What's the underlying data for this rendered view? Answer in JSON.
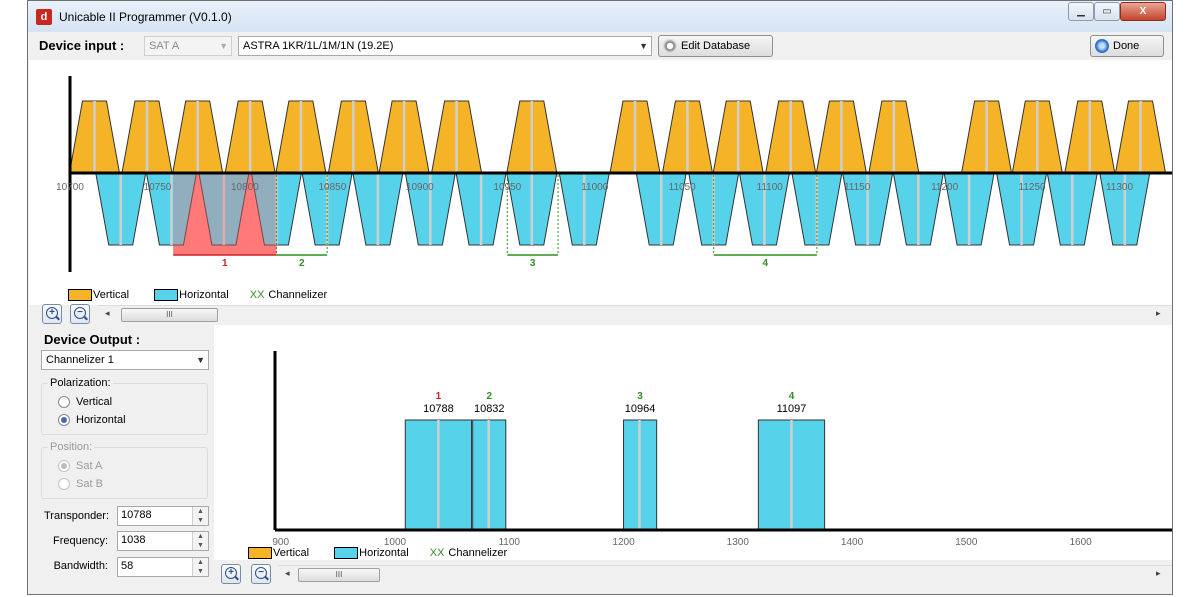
{
  "window": {
    "title": "Unicable II Programmer (V0.1.0)",
    "icon_letter": "d"
  },
  "window_buttons": {
    "minimize": "▁",
    "maximize": "▭",
    "close": "X"
  },
  "toolbar": {
    "device_input_label": "Device input :",
    "sat_select": "SAT A",
    "satellite_select": "ASTRA 1KR/1L/1M/1N (19.2E)",
    "edit_database_label": "Edit Database",
    "done_label": "Done"
  },
  "colors": {
    "vertical": "#f5b327",
    "horizontal": "#56d3eb",
    "channelizer_red": "#ff6b6b",
    "channelizer_green": "#2f8f1f"
  },
  "legend": {
    "vertical": "Vertical",
    "horizontal": "Horizontal",
    "channelizer_xx": "XX",
    "channelizer": "Channelizer"
  },
  "scrollbar": {
    "thumb_glyph": "III",
    "left": "◂",
    "right": "▸"
  },
  "chart_data": [
    {
      "type": "bar",
      "name": "transponder-spectrum",
      "x_ticks": [
        10700,
        10750,
        10800,
        10850,
        10900,
        10950,
        11000,
        11050,
        11100,
        11150,
        11200,
        11250,
        11300
      ],
      "x_tick_labels": [
        "10700",
        "10750",
        "10800",
        "10850",
        "10900",
        "10950",
        "11000",
        "11050",
        "11100",
        "11150",
        "11200",
        "11250",
        "11300"
      ],
      "xlim": [
        10700,
        11330
      ],
      "vertical_transponders": [
        10714,
        10744,
        10773,
        10803,
        10832,
        10862,
        10891,
        10921,
        10964,
        11023,
        11053,
        11082,
        11112,
        11141,
        11171,
        11224,
        11253,
        11283,
        11312
      ],
      "horizontal_transponders": [
        10729,
        10758,
        10788,
        10818,
        10847,
        10876,
        10906,
        10935,
        10964,
        10994,
        11038,
        11068,
        11097,
        11127,
        11156,
        11185,
        11214,
        11244,
        11273,
        11303
      ],
      "channelizers": [
        {
          "label": "1",
          "start": 10759,
          "end": 10818,
          "color": "red"
        },
        {
          "label": "2",
          "start": 10818,
          "end": 10847,
          "color": "green"
        },
        {
          "label": "3",
          "start": 10950,
          "end": 10979,
          "color": "green"
        },
        {
          "label": "4",
          "start": 11068,
          "end": 11127,
          "color": "green"
        }
      ]
    },
    {
      "type": "bar",
      "name": "device-output",
      "x_ticks": [
        900,
        1000,
        1100,
        1200,
        1300,
        1400,
        1500,
        1600
      ],
      "x_tick_labels": [
        "900",
        "1000",
        "1100",
        "1200",
        "1300",
        "1400",
        "1500",
        "1600"
      ],
      "xlim": [
        895,
        1680
      ],
      "channels": [
        {
          "label": "1",
          "frequency_label": "10788",
          "start": 1009,
          "end": 1067,
          "center": 1038,
          "color": "red"
        },
        {
          "label": "2",
          "frequency_label": "10832",
          "start": 1068,
          "end": 1097,
          "center": 1082,
          "color": "green"
        },
        {
          "label": "3",
          "frequency_label": "10964",
          "start": 1200,
          "end": 1229,
          "center": 1214,
          "color": "green"
        },
        {
          "label": "4",
          "frequency_label": "11097",
          "start": 1318,
          "end": 1376,
          "center": 1347,
          "color": "green"
        }
      ]
    }
  ],
  "device_output": {
    "label": "Device Output :",
    "channelizer_select": "Channelizer 1",
    "polarization": {
      "title": "Polarization:",
      "options": [
        "Vertical",
        "Horizontal"
      ],
      "selected": "Horizontal"
    },
    "position": {
      "title": "Position:",
      "options": [
        "Sat A",
        "Sat B"
      ],
      "selected": "Sat A"
    },
    "fields": {
      "transponder_label": "Transponder:",
      "transponder_value": "10788",
      "frequency_label": "Frequency:",
      "frequency_value": "1038",
      "bandwidth_label": "Bandwidth:",
      "bandwidth_value": "58"
    }
  }
}
